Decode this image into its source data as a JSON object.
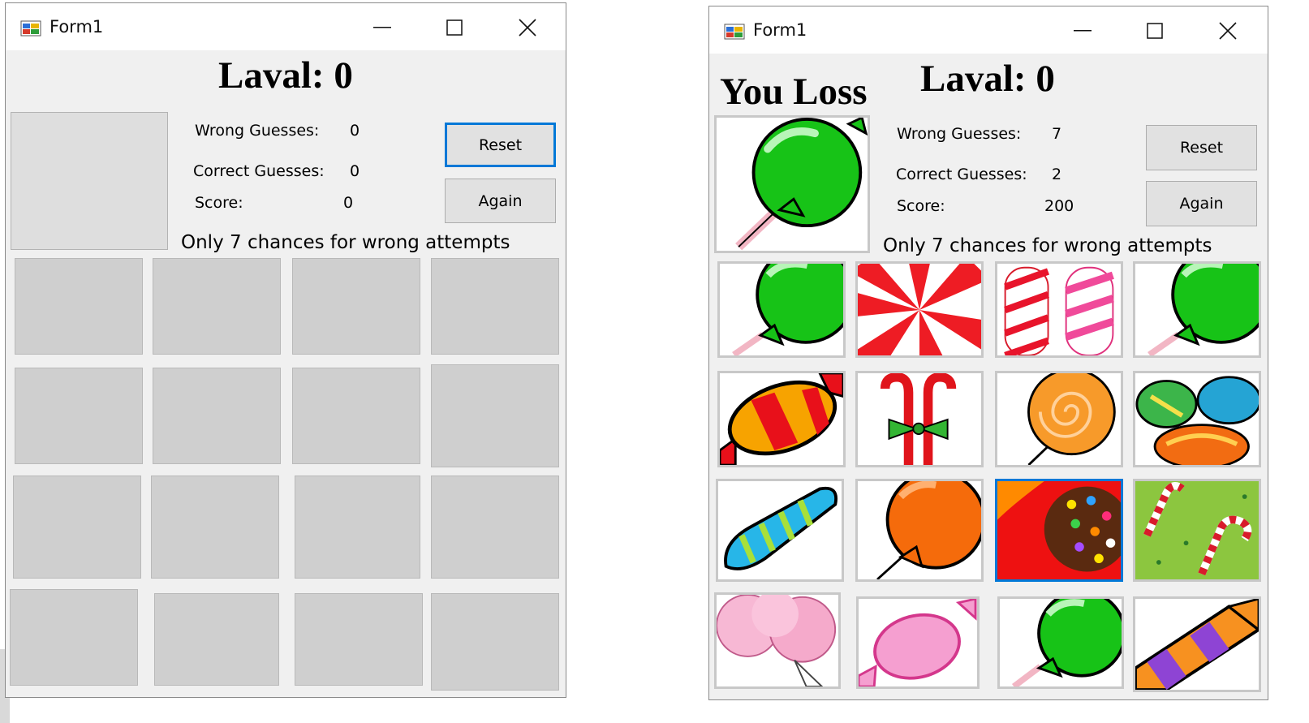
{
  "left": {
    "title": "Form1",
    "level_label": "Laval:",
    "level_value": "0",
    "wrong_label": "Wrong Guesses:",
    "wrong_value": "0",
    "correct_label": "Correct Guesses:",
    "correct_value": "0",
    "score_label": "Score:",
    "score_value": "0",
    "reset_label": "Reset",
    "again_label": "Again",
    "chances_text": "Only 7 chances for wrong attempts"
  },
  "right": {
    "title": "Form1",
    "result_text": "You Loss",
    "level_label": "Laval:",
    "level_value": "0",
    "wrong_label": "Wrong Guesses:",
    "wrong_value": "7",
    "correct_label": "Correct Guesses:",
    "correct_value": "2",
    "score_label": "Score:",
    "score_value": "200",
    "reset_label": "Reset",
    "again_label": "Again",
    "chances_text": "Only 7 chances for wrong attempts",
    "preview_image": "green-lollipop-image",
    "tiles": [
      "green-lollipop-image",
      "peppermint-swirl-image",
      "striped-candy-sticks-image",
      "green-lollipop-image",
      "wrapped-striped-candy-image",
      "candy-cane-bow-image",
      "orange-swirl-lollipop-image",
      "candy-pile-image",
      "blue-striped-candy-image",
      "orange-lollipop-image",
      "candy-crush-image",
      "candy-cane-pattern-image",
      "cotton-candy-image",
      "pink-wrapped-candy-image",
      "green-lollipop-image",
      "purple-striped-candy-image"
    ]
  },
  "colors": {
    "accent_focus": "#0078d7",
    "tile_hidden": "#cfcfcf",
    "window_bg": "#f0f0f0"
  }
}
